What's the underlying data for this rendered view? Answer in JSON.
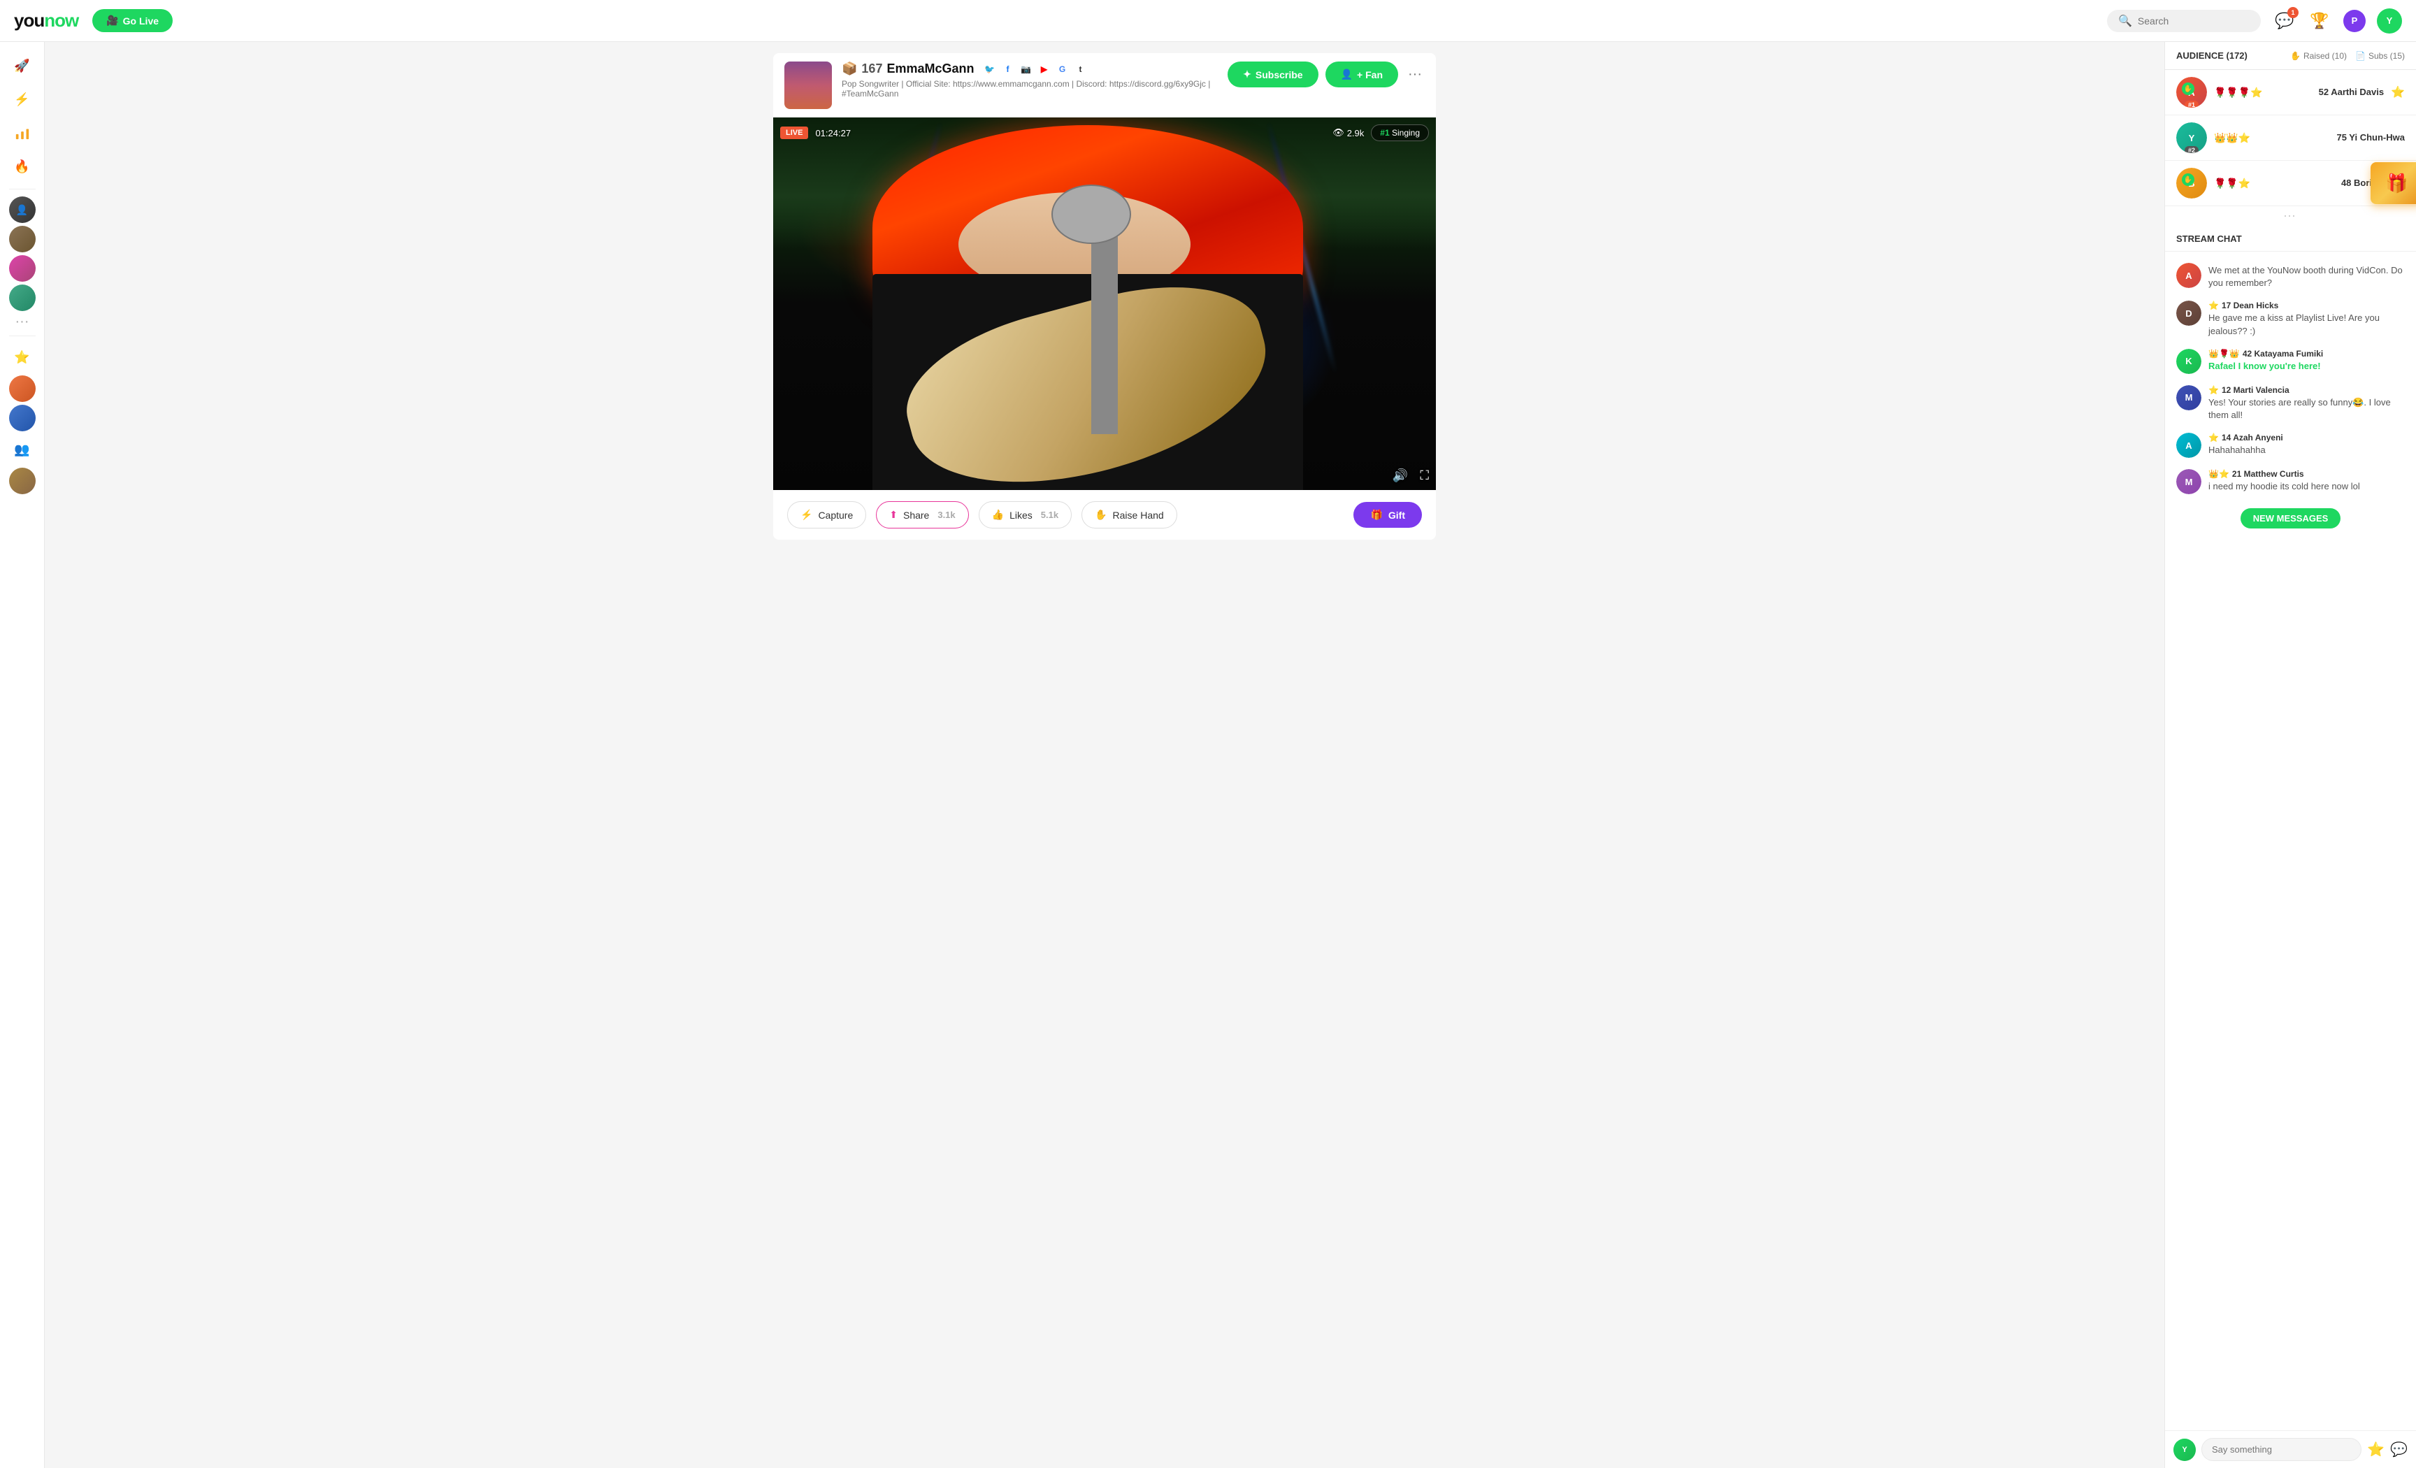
{
  "nav": {
    "logo": "younow",
    "go_live": "Go Live",
    "search_placeholder": "Search",
    "notification_count": "1",
    "profile_initial": "Y"
  },
  "sidebar": {
    "icons": [
      "🚀",
      "⚡",
      "⭐",
      "🔥",
      "👤",
      "👤",
      "👤",
      "👤",
      "👤",
      "···",
      "⭐",
      "👤",
      "👤"
    ]
  },
  "streamer": {
    "emoji": "📦",
    "rank": "167",
    "name": "EmmaMcGann",
    "bio": "Pop Songwriter | Official Site: https://www.emmamcgann.com | Discord: https://discord.gg/6xy9Gjc | #TeamMcGann",
    "subscribe_label": "Subscribe",
    "fan_label": "+ Fan",
    "live_badge": "LIVE",
    "duration": "01:24:27",
    "views": "2.9k",
    "category": "#1 Singing"
  },
  "actions": {
    "capture": "Capture",
    "share": "Share",
    "share_count": "3.1k",
    "likes": "Likes",
    "likes_count": "5.1k",
    "raise_hand": "Raise Hand",
    "gift": "Gift"
  },
  "audience": {
    "title": "AUDIENCE (172)",
    "raised_label": "Raised (10)",
    "subs_label": "Subs (15)",
    "members": [
      {
        "name": "52 Aarthi Davis",
        "emojis": "🌹🌹🌹⭐",
        "rank": "#1",
        "rank_class": "rank1",
        "color": "av-red"
      },
      {
        "name": "75 Yi Chun-Hwa",
        "emojis": "👑👑⭐",
        "rank": "#2",
        "rank_class": "rank2",
        "color": "av-teal"
      },
      {
        "name": "48 Boris Ukhtc",
        "emojis": "🌹🌹⭐",
        "rank": "",
        "rank_class": "",
        "color": "av-orange"
      }
    ]
  },
  "chat": {
    "title": "STREAM CHAT",
    "messages": [
      {
        "username": "",
        "text": "We met at the YouNow booth during VidCon. Do you remember?",
        "color": "av-red",
        "initial": "A",
        "badge": ""
      },
      {
        "username": "17 Dean Hicks",
        "text": "He gave me a kiss at Playlist Live! Are you jealous?? :)",
        "color": "av-brown",
        "initial": "D",
        "badge": "⭐"
      },
      {
        "username": "42 Katayama Fumiki",
        "text": "Rafael I know you're here!",
        "text_highlight": true,
        "color": "av-green",
        "initial": "K",
        "badge": "👑🌹👑"
      },
      {
        "username": "12 Marti Valencia",
        "text": "Yes! Your stories are really so funny😂. I love them all!",
        "color": "av-indigo",
        "initial": "M",
        "badge": "⭐"
      },
      {
        "username": "14 Azah Anyeni",
        "text": "Hahahahahha",
        "color": "av-cyan",
        "initial": "A",
        "badge": "⭐"
      },
      {
        "username": "21 Matthew Curtis",
        "text": "i need my hoodie its cold here now lol",
        "color": "av-purple",
        "initial": "M",
        "badge": "👑⭐"
      }
    ],
    "new_messages_btn": "NEW MESSAGES",
    "input_placeholder": "Say something",
    "user_initial": "Y"
  }
}
